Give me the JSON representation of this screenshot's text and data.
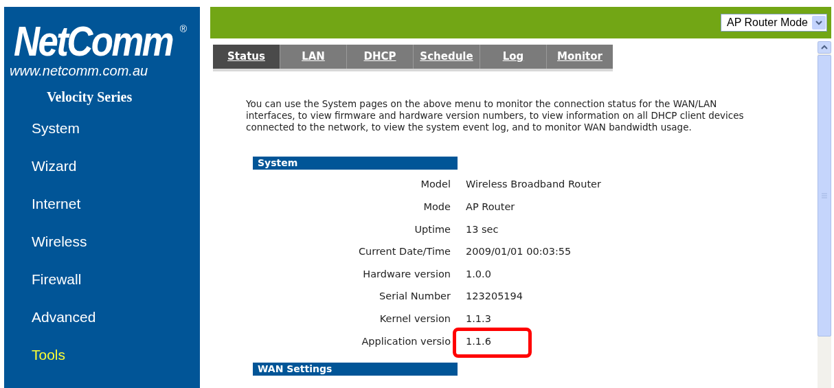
{
  "brand": {
    "logo": "NetComm",
    "registered": "®",
    "url": "www.netcomm.com.au",
    "series": "Velocity Series"
  },
  "sidebar": {
    "items": [
      {
        "label": "System",
        "selected": false
      },
      {
        "label": "Wizard",
        "selected": false
      },
      {
        "label": "Internet",
        "selected": false
      },
      {
        "label": "Wireless",
        "selected": false
      },
      {
        "label": "Firewall",
        "selected": false
      },
      {
        "label": "Advanced",
        "selected": false
      },
      {
        "label": "Tools",
        "selected": true
      }
    ]
  },
  "mode_select": {
    "value": "AP Router Mode"
  },
  "tabs": [
    {
      "label": "Status",
      "selected": true
    },
    {
      "label": "LAN",
      "selected": false
    },
    {
      "label": "DHCP",
      "selected": false
    },
    {
      "label": "Schedule",
      "selected": false
    },
    {
      "label": "Log",
      "selected": false
    },
    {
      "label": "Monitor",
      "selected": false
    }
  ],
  "intro": "You can use the System pages on the above menu to monitor the connection status for the WAN/LAN interfaces, to view firmware and hardware version numbers, to view information on all DHCP client devices connected to the network, to view the system event log, and to monitor WAN bandwidth usage.",
  "sections": [
    {
      "title": "System",
      "rows": [
        {
          "label": "Model",
          "value": "Wireless Broadband Router",
          "highlighted": false
        },
        {
          "label": "Mode",
          "value": "AP Router",
          "highlighted": false
        },
        {
          "label": "Uptime",
          "value": "13 sec",
          "highlighted": false
        },
        {
          "label": "Current Date/Time",
          "value": "2009/01/01 00:03:55",
          "highlighted": false
        },
        {
          "label": "Hardware version",
          "value": "1.0.0",
          "highlighted": false
        },
        {
          "label": "Serial Number",
          "value": "123205194",
          "highlighted": false
        },
        {
          "label": "Kernel version",
          "value": "1.1.3",
          "highlighted": false
        },
        {
          "label": "Application versio",
          "value": "1.1.6",
          "highlighted": true
        }
      ]
    },
    {
      "title": "WAN Settings"
    }
  ]
}
